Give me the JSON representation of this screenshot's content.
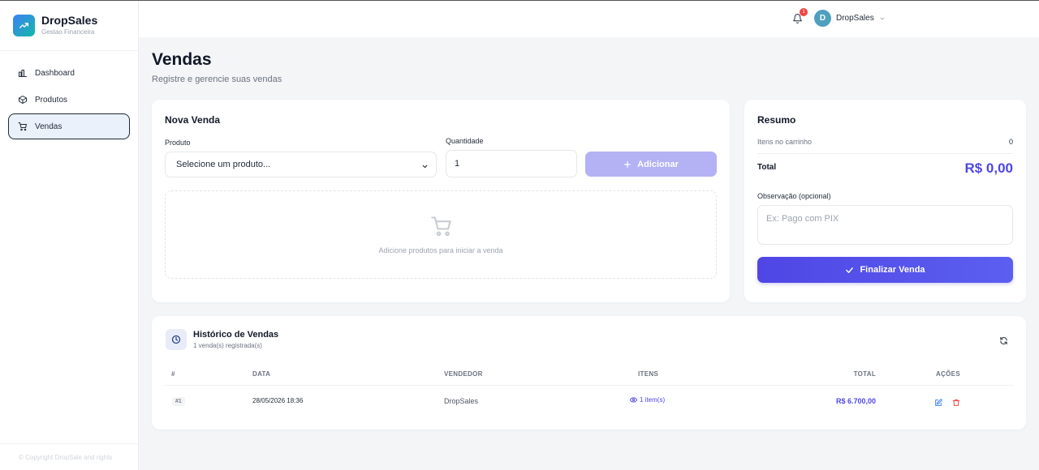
{
  "brand": {
    "name": "DropSales",
    "subtitle": "Gestao Financeira"
  },
  "sidebar": {
    "items": [
      {
        "label": "Dashboard",
        "icon": "bar-chart-icon",
        "active": false
      },
      {
        "label": "Produtos",
        "icon": "box-icon",
        "active": false
      },
      {
        "label": "Vendas",
        "icon": "cart-icon",
        "active": true
      }
    ],
    "copyright": "© Copyright DropSale and rights"
  },
  "header": {
    "notification_count": "1",
    "user_initial": "D",
    "user_name": "DropSales"
  },
  "page": {
    "title": "Vendas",
    "subtitle": "Registre e gerencie suas vendas"
  },
  "new_sale": {
    "title": "Nova Venda",
    "product_label": "Produto",
    "product_value": "Selecione um produto...",
    "quantity_label": "Quantidade",
    "quantity_value": "1",
    "add_label": "Adicionar",
    "empty_text": "Adicione produtos para iniciar a venda"
  },
  "summary": {
    "title": "Resumo",
    "cart_label": "Itens no carrinho",
    "cart_count": "0",
    "total_label": "Total",
    "total_value": "R$ 0,00",
    "note_label": "Observação (opcional)",
    "note_placeholder": "Ex: Pago com PIX",
    "finalize_label": "Finalizar Venda"
  },
  "history": {
    "title": "Histórico de Vendas",
    "subtitle": "1 venda(s) registrada(s)",
    "columns": [
      "#",
      "DATA",
      "VENDEDOR",
      "ITENS",
      "TOTAL",
      "AÇÕES"
    ],
    "rows": [
      {
        "id": "#1",
        "date": "28/05/2026 18:36",
        "seller": "DropSales",
        "items": "1 item(s)",
        "total": "R$ 6.700,00"
      }
    ]
  },
  "colors": {
    "accent": "#4f46e5",
    "accent_disabled": "#b4b1f4",
    "danger": "#ef4444",
    "edit": "#3b82f6"
  }
}
